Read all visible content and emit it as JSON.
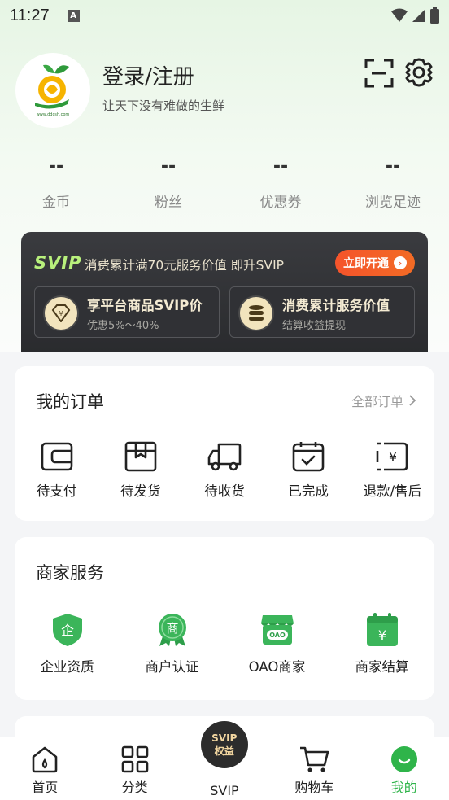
{
  "status": {
    "time": "11:27",
    "indicator": "A"
  },
  "profile": {
    "title": "登录/注册",
    "subtitle": "让天下没有难做的生鲜",
    "logo_text": "www.ddcsh.com"
  },
  "stats": [
    {
      "value": "--",
      "label": "金币"
    },
    {
      "value": "--",
      "label": "粉丝"
    },
    {
      "value": "--",
      "label": "优惠券"
    },
    {
      "value": "--",
      "label": "浏览足迹"
    }
  ],
  "svip": {
    "logo": "SVIP",
    "desc": "消费累计满70元服务价值 即升SVIP",
    "open_label": "立即开通",
    "perks": [
      {
        "title": "享平台商品SVIP价",
        "sub": "优惠5%～40%"
      },
      {
        "title": "消费累计服务价值",
        "sub": "结算收益提现"
      }
    ]
  },
  "orders": {
    "title": "我的订单",
    "more": "全部订单",
    "items": [
      {
        "label": "待支付",
        "icon": "wallet-icon"
      },
      {
        "label": "待发货",
        "icon": "package-icon"
      },
      {
        "label": "待收货",
        "icon": "truck-icon"
      },
      {
        "label": "已完成",
        "icon": "calendar-check-icon"
      },
      {
        "label": "退款/售后",
        "icon": "refund-icon"
      }
    ]
  },
  "merchant": {
    "title": "商家服务",
    "items": [
      {
        "label": "企业资质",
        "icon": "shield-enterprise-icon",
        "badge": "企"
      },
      {
        "label": "商户认证",
        "icon": "merchant-badge-icon",
        "badge": "商"
      },
      {
        "label": "OAO商家",
        "icon": "store-icon",
        "badge": "OAO"
      },
      {
        "label": "商家结算",
        "icon": "calendar-yen-icon",
        "badge": "¥"
      }
    ]
  },
  "tabbar": {
    "items": [
      {
        "label": "首页"
      },
      {
        "label": "分类"
      },
      {
        "label": "SVIP",
        "bubble_line1": "SVIP",
        "bubble_line2": "权益"
      },
      {
        "label": "购物车"
      },
      {
        "label": "我的"
      }
    ],
    "active_color": "#2fb44a"
  },
  "colors": {
    "brand_green": "#2fb44a",
    "svip_orange": "#f5542b"
  }
}
